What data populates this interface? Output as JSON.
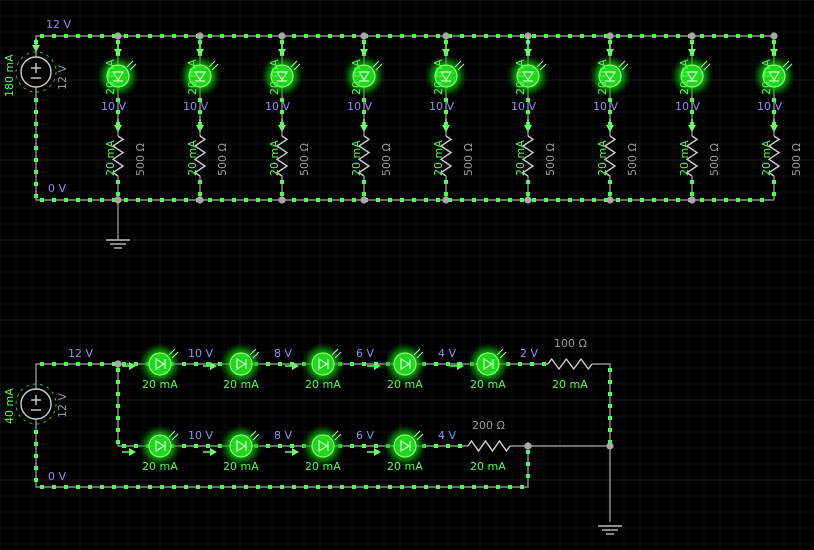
{
  "circuit_top": {
    "source": {
      "current": "180 mA",
      "voltage": "12 V"
    },
    "rail_high": "12 V",
    "rail_low": "0 V",
    "branches": [
      {
        "led_current": "20 mA",
        "node_voltage": "10 V",
        "res_current": "20 mA",
        "resistance": "500 Ω"
      },
      {
        "led_current": "20 mA",
        "node_voltage": "10 V",
        "res_current": "20 mA",
        "resistance": "500 Ω"
      },
      {
        "led_current": "20 mA",
        "node_voltage": "10 V",
        "res_current": "20 mA",
        "resistance": "500 Ω"
      },
      {
        "led_current": "20 mA",
        "node_voltage": "10 V",
        "res_current": "20 mA",
        "resistance": "500 Ω"
      },
      {
        "led_current": "20 mA",
        "node_voltage": "10 V",
        "res_current": "20 mA",
        "resistance": "500 Ω"
      },
      {
        "led_current": "20 mA",
        "node_voltage": "10 V",
        "res_current": "20 mA",
        "resistance": "500 Ω"
      },
      {
        "led_current": "20 mA",
        "node_voltage": "10 V",
        "res_current": "20 mA",
        "resistance": "500 Ω"
      },
      {
        "led_current": "20 mA",
        "node_voltage": "10 V",
        "res_current": "20 mA",
        "resistance": "500 Ω"
      },
      {
        "led_current": "20 mA",
        "node_voltage": "10 V",
        "res_current": "20 mA",
        "resistance": "500 Ω"
      }
    ]
  },
  "circuit_bottom": {
    "source": {
      "current": "40 mA",
      "voltage": "12 V"
    },
    "rail_high": "12 V",
    "rail_low": "0 V",
    "row1": {
      "leds": [
        {
          "current": "20 mA",
          "voltage_after": "10 V"
        },
        {
          "current": "20 mA",
          "voltage_after": "8 V"
        },
        {
          "current": "20 mA",
          "voltage_after": "6 V"
        },
        {
          "current": "20 mA",
          "voltage_after": "4 V"
        },
        {
          "current": "20 mA",
          "voltage_after": "2 V"
        }
      ],
      "resistor": {
        "value": "100 Ω",
        "current": "20 mA"
      }
    },
    "row2": {
      "leds": [
        {
          "current": "20 mA",
          "voltage_after": "10 V"
        },
        {
          "current": "20 mA",
          "voltage_after": "8 V"
        },
        {
          "current": "20 mA",
          "voltage_after": "6 V"
        },
        {
          "current": "20 mA",
          "voltage_after": "4 V"
        }
      ],
      "resistor": {
        "value": "200 Ω",
        "current": "20 mA"
      }
    }
  },
  "colors": {
    "wire": "#8f8f8f",
    "current_dot": "#4cff4c",
    "voltage_label": "#8e8ef0",
    "value_label": "#9a9a9a",
    "led_glow": "#22ff22"
  }
}
